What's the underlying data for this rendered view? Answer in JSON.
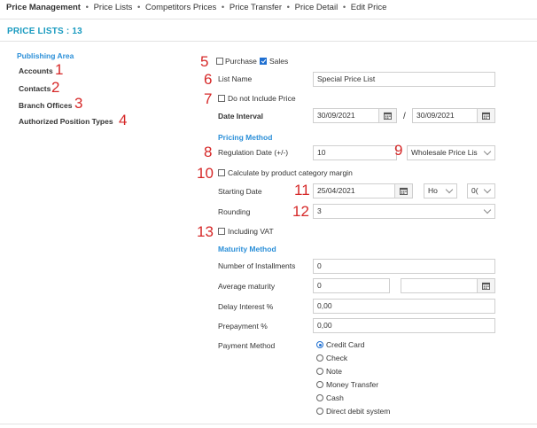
{
  "nav": {
    "active": "Price Management",
    "items": [
      "Price Lists",
      "Competitors Prices",
      "Price Transfer",
      "Price Detail",
      "Edit Price"
    ],
    "separator": "•"
  },
  "header": {
    "title": "PRICE LISTS : 13"
  },
  "sidebar": {
    "section_title": "Publishing Area",
    "items": [
      {
        "label": "Accounts",
        "marker": "1"
      },
      {
        "label": "Contacts",
        "marker": "2"
      },
      {
        "label": "Branch Offices",
        "marker": "3"
      },
      {
        "label": "Authorized Position Types",
        "marker": "4"
      }
    ]
  },
  "form": {
    "purchase": {
      "marker": "5",
      "label": "Purchase",
      "checked": false
    },
    "sales": {
      "label": "Sales",
      "checked": true
    },
    "list_name": {
      "marker": "6",
      "label": "List Name",
      "value": "Special Price List"
    },
    "do_not_include_price": {
      "marker": "7",
      "label": "Do not Include Price",
      "checked": false
    },
    "date_interval": {
      "label": "Date Interval",
      "from": "30/09/2021",
      "separator": "/",
      "to": "30/09/2021"
    },
    "pricing_method": {
      "title": "Pricing Method"
    },
    "regulation_date": {
      "marker": "8",
      "label": "Regulation Date (+/-)",
      "value": "10"
    },
    "price_list_select": {
      "marker": "9",
      "value": "Wholesale Price Lis"
    },
    "calculate_by_category": {
      "marker": "10",
      "label": "Calculate by product category margin",
      "checked": false
    },
    "starting_date": {
      "marker": "11",
      "label": "Starting Date",
      "value": "25/04/2021",
      "hour": "Ho",
      "minute": "0("
    },
    "rounding": {
      "marker": "12",
      "label": "Rounding",
      "value": "3"
    },
    "including_vat": {
      "marker": "13",
      "label": "Including VAT",
      "checked": false
    },
    "maturity_method": {
      "title": "Maturity Method"
    },
    "installments": {
      "label": "Number of Installments",
      "value": "0"
    },
    "average_maturity": {
      "label": "Average maturity",
      "value": "0",
      "date": ""
    },
    "delay_interest": {
      "label": "Delay Interest %",
      "value": "0,00"
    },
    "prepayment": {
      "label": "Prepayment %",
      "value": "0,00"
    },
    "payment_method": {
      "label": "Payment Method",
      "options": [
        "Credit Card",
        "Check",
        "Note",
        "Money Transfer",
        "Cash",
        "Direct debit system"
      ],
      "selected_index": 0
    }
  },
  "colors": {
    "accent": "#1a9bc0",
    "section_title": "#2b8fd8",
    "marker": "#d62828",
    "checkbox": "#1f6fd1"
  }
}
